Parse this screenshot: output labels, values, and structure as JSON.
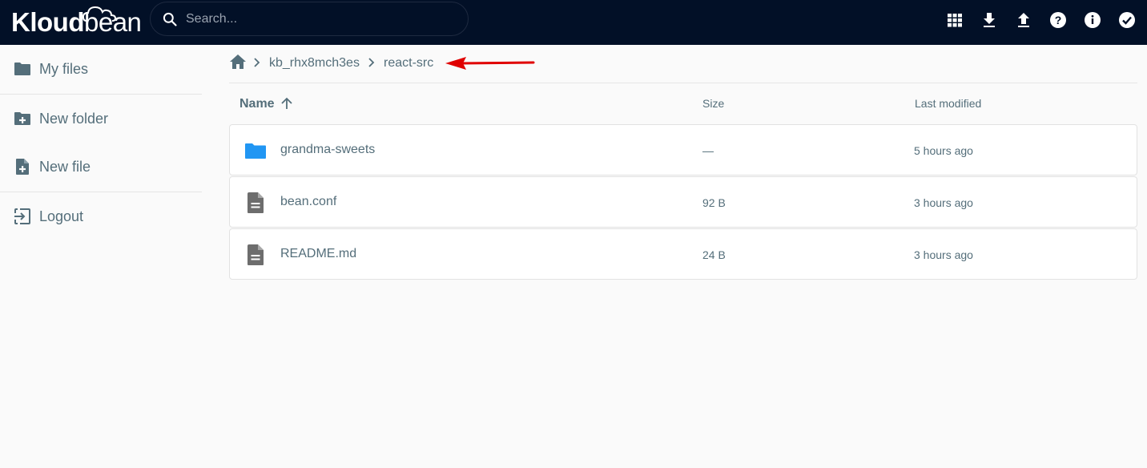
{
  "app": {
    "logo_text_bold": "Kloud",
    "logo_text_light": "bean"
  },
  "search": {
    "placeholder": "Search..."
  },
  "header_actions": [
    {
      "icon": "grid-view-icon"
    },
    {
      "icon": "download-icon"
    },
    {
      "icon": "upload-icon"
    },
    {
      "icon": "help-icon"
    },
    {
      "icon": "info-icon"
    },
    {
      "icon": "check-circle-icon"
    }
  ],
  "sidebar": {
    "items": [
      {
        "label": "My files",
        "icon": "folder-icon"
      },
      {
        "label": "New folder",
        "icon": "create-folder-icon"
      },
      {
        "label": "New file",
        "icon": "create-file-icon"
      },
      {
        "label": "Logout",
        "icon": "logout-icon"
      }
    ]
  },
  "breadcrumb": {
    "home_icon": "home-icon",
    "items": [
      "kb_rhx8mch3es",
      "react-src"
    ]
  },
  "annotation": {
    "arrow_color": "#e00000"
  },
  "table": {
    "columns": {
      "name": "Name",
      "size": "Size",
      "modified": "Last modified"
    },
    "rows": [
      {
        "name": "grandma-sweets",
        "size": "—",
        "modified": "5 hours ago",
        "type": "folder"
      },
      {
        "name": "bean.conf",
        "size": "92 B",
        "modified": "3 hours ago",
        "type": "file"
      },
      {
        "name": "README.md",
        "size": "24 B",
        "modified": "3 hours ago",
        "type": "file"
      }
    ]
  },
  "colors": {
    "header_bg": "#021027",
    "folder_icon": "#2196f3",
    "file_icon": "#6d6d6d",
    "text": "#546e7a"
  }
}
